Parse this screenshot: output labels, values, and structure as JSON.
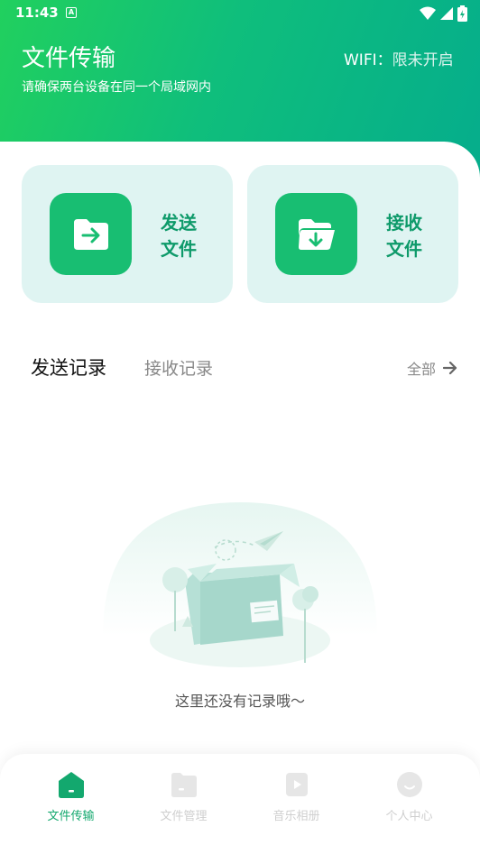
{
  "status_bar": {
    "time": "11:43",
    "badge": "A"
  },
  "header": {
    "title": "文件传输",
    "subtitle": "请确保两台设备在同一个局域网内",
    "wifi_label": "WIFI：",
    "wifi_value": "限未开启"
  },
  "actions": {
    "send": {
      "line1": "发送",
      "line2": "文件",
      "icon": "folder-arrow-right-icon"
    },
    "receive": {
      "line1": "接收",
      "line2": "文件",
      "icon": "folder-arrow-down-icon"
    }
  },
  "tabs": {
    "send": "发送记录",
    "receive": "接收记录",
    "all": "全部"
  },
  "empty_state": {
    "text": "这里还没有记录哦～"
  },
  "bottom_nav": {
    "items": [
      {
        "label": "文件传输",
        "icon": "home-icon",
        "active": true
      },
      {
        "label": "文件管理",
        "icon": "folder-icon",
        "active": false
      },
      {
        "label": "音乐相册",
        "icon": "media-icon",
        "active": false
      },
      {
        "label": "个人中心",
        "icon": "profile-icon",
        "active": false
      }
    ]
  },
  "colors": {
    "accent": "#18be72",
    "header_start": "#21d05e",
    "header_end": "#05ad8c",
    "card_bg": "#dff4f2",
    "card_text": "#0e9a6a"
  }
}
